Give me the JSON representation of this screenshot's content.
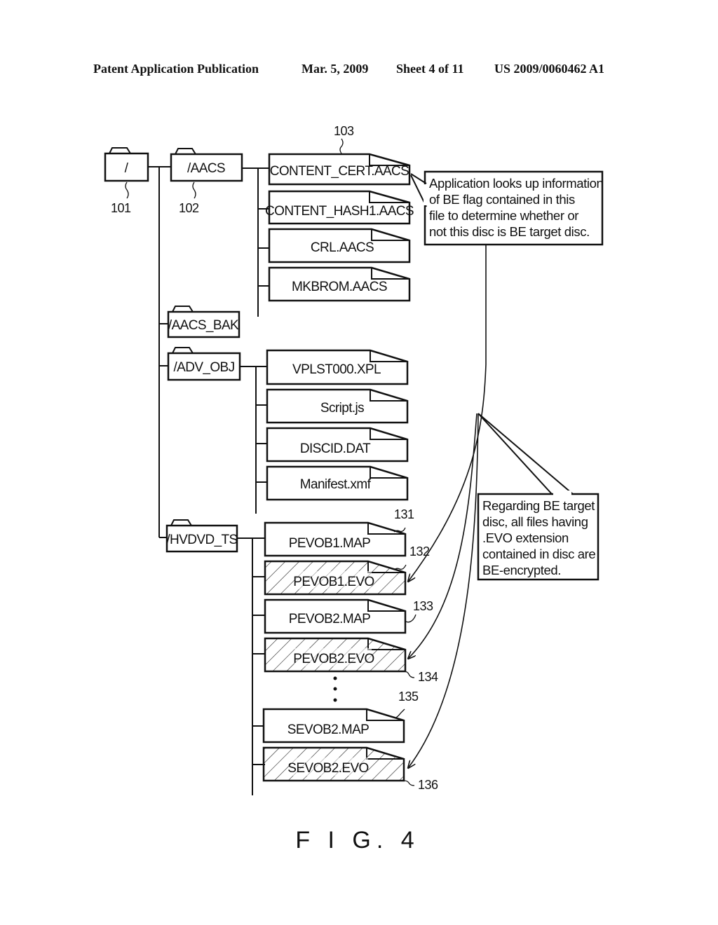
{
  "header": {
    "left": "Patent Application Publication",
    "date": "Mar. 5, 2009",
    "sheet": "Sheet 4 of 11",
    "number": "US 2009/0060462 A1"
  },
  "folders": {
    "root": {
      "label": "/",
      "ref": "101"
    },
    "aacs": {
      "label": "/AACS",
      "ref": "102"
    },
    "aacs_bak": {
      "label": "/AACS_BAK"
    },
    "adv_obj": {
      "label": "/ADV_OBJ"
    },
    "hvdvd_ts": {
      "label": "/HVDVD_TS"
    }
  },
  "aacs_files": [
    {
      "label": "CONTENT_CERT.AACS",
      "ref": "103"
    },
    {
      "label": "CONTENT_HASH1.AACS"
    },
    {
      "label": "CRL.AACS"
    },
    {
      "label": "MKBROM.AACS"
    }
  ],
  "adv_obj_files": [
    {
      "label": "VPLST000.XPL"
    },
    {
      "label": "Script.js"
    },
    {
      "label": "DISCID.DAT"
    },
    {
      "label": "Manifest.xmf"
    }
  ],
  "hvdvd_files": [
    {
      "label": "PEVOB1.MAP",
      "ref": "131",
      "encrypted": false
    },
    {
      "label": "PEVOB1.EVO",
      "ref": "132",
      "encrypted": true
    },
    {
      "label": "PEVOB2.MAP",
      "ref": "133",
      "encrypted": false
    },
    {
      "label": "PEVOB2.EVO",
      "ref": "134",
      "encrypted": true
    },
    {
      "label": "SEVOB2.MAP",
      "ref": "135",
      "encrypted": false
    },
    {
      "label": "SEVOB2.EVO",
      "ref": "136",
      "encrypted": true
    }
  ],
  "notes": {
    "be_flag": [
      "Application looks up information",
      "of BE flag contained in this",
      "file to determine whether or",
      "not this disc is BE target disc."
    ],
    "be_encrypted": [
      "Regarding BE target",
      "disc, all files having",
      ".EVO extension",
      "contained in disc are",
      "BE-encrypted."
    ]
  },
  "figure_label": "F I G. 4"
}
